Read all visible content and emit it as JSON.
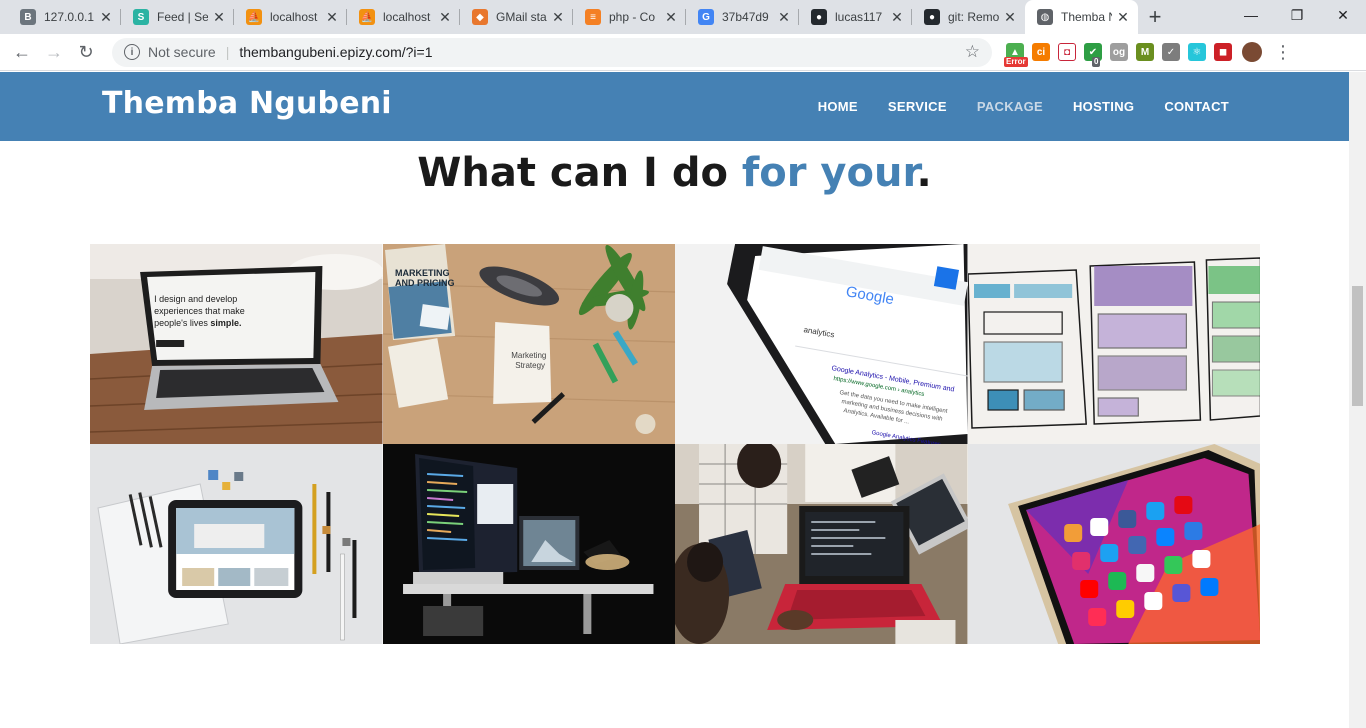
{
  "browser": {
    "tabs": [
      {
        "title": "127.0.0.1",
        "icon": "bootstrap-icon",
        "color": "#6c757d",
        "glyph": "B"
      },
      {
        "title": "Feed | Se",
        "icon": "s-logo-icon",
        "color": "#2bb3a3",
        "glyph": "S"
      },
      {
        "title": "localhost",
        "icon": "phpmyadmin-icon",
        "color": "#f29111",
        "glyph": "⛵"
      },
      {
        "title": "localhost",
        "icon": "phpmyadmin-icon",
        "color": "#f29111",
        "glyph": "⛵"
      },
      {
        "title": "GMail sta",
        "icon": "shield-icon",
        "color": "#e8772e",
        "glyph": "◆"
      },
      {
        "title": "php - Co",
        "icon": "stackoverflow-icon",
        "color": "#f48024",
        "glyph": "≡"
      },
      {
        "title": "37b47d9",
        "icon": "google-icon",
        "color": "#4285f4",
        "glyph": "G"
      },
      {
        "title": "lucas117",
        "icon": "github-icon",
        "color": "#24292e",
        "glyph": "●"
      },
      {
        "title": "git: Remo",
        "icon": "github-icon",
        "color": "#24292e",
        "glyph": "●"
      },
      {
        "title": "Themba N",
        "icon": "globe-icon",
        "color": "#5f6368",
        "glyph": "◍"
      }
    ],
    "new_tab": "+",
    "window_controls": {
      "minimize": "—",
      "restore": "❐",
      "close": "✕"
    },
    "toolbar": {
      "back": "←",
      "forward": "→",
      "reload": "↻",
      "security_label": "Not secure",
      "url": "thembangubeni.epizy.com/?i=1",
      "star": "☆"
    },
    "extensions": [
      {
        "name": "error-extension-icon",
        "color": "#4caf50",
        "glyph": "▲",
        "badge": "Error",
        "badge_style": "red"
      },
      {
        "name": "ci-extension-icon",
        "color": "#f57c00",
        "glyph": "ci",
        "badge": "",
        "badge_style": ""
      },
      {
        "name": "pocket-extension-icon",
        "color": "#ffffff",
        "glyph": "◘",
        "badge": "",
        "badge_style": ""
      },
      {
        "name": "ublock-extension-icon",
        "color": "#2e9e44",
        "glyph": "✔",
        "badge": "0",
        "badge_style": "gray"
      },
      {
        "name": "og-extension-icon",
        "color": "#9e9e9e",
        "glyph": "og",
        "badge": "",
        "badge_style": ""
      },
      {
        "name": "m-extension-icon",
        "color": "#6a8f1f",
        "glyph": "M",
        "badge": "",
        "badge_style": ""
      },
      {
        "name": "check-extension-icon",
        "color": "#7d7d7d",
        "glyph": "✓",
        "badge": "",
        "badge_style": ""
      },
      {
        "name": "react-extension-icon",
        "color": "#26c6da",
        "glyph": "⚛",
        "badge": "",
        "badge_style": ""
      },
      {
        "name": "lastpass-extension-icon",
        "color": "#cc2027",
        "glyph": "◼",
        "badge": "",
        "badge_style": ""
      }
    ],
    "menu": "⋮"
  },
  "site": {
    "brand": "Themba Ngubeni",
    "nav": [
      {
        "label": "HOME",
        "active": false
      },
      {
        "label": "SERVICE",
        "active": false
      },
      {
        "label": "PACKAGE",
        "active": true
      },
      {
        "label": "HOSTING",
        "active": false
      },
      {
        "label": "CONTACT",
        "active": false
      }
    ],
    "heading_prefix": "What can I do ",
    "heading_accent": "for your",
    "heading_suffix": ".",
    "gallery_texts": {
      "laptop_line1": "I design and develop",
      "laptop_line2": "experiences that make",
      "laptop_line3": "people's lives",
      "laptop_bold": "simple.",
      "book_line1": "MARKETING",
      "book_line2": "AND PRICING",
      "paper_line1": "Marketing",
      "paper_line2": "Strategy",
      "google_logo": "Google",
      "search_query": "analytics",
      "result_title": "Google Analytics - Mobile, Premium and",
      "result_url": "https://www.google.com › analytics",
      "result_line1": "Get the data you need to make intelligent",
      "result_line2": "marketing and business decisions with",
      "result_line3": "Analytics. Available for ...",
      "result_footer": "Google Analytics Features"
    },
    "colors": {
      "brand": "#4581b4",
      "nav_dim": "#c9d8e6"
    }
  }
}
